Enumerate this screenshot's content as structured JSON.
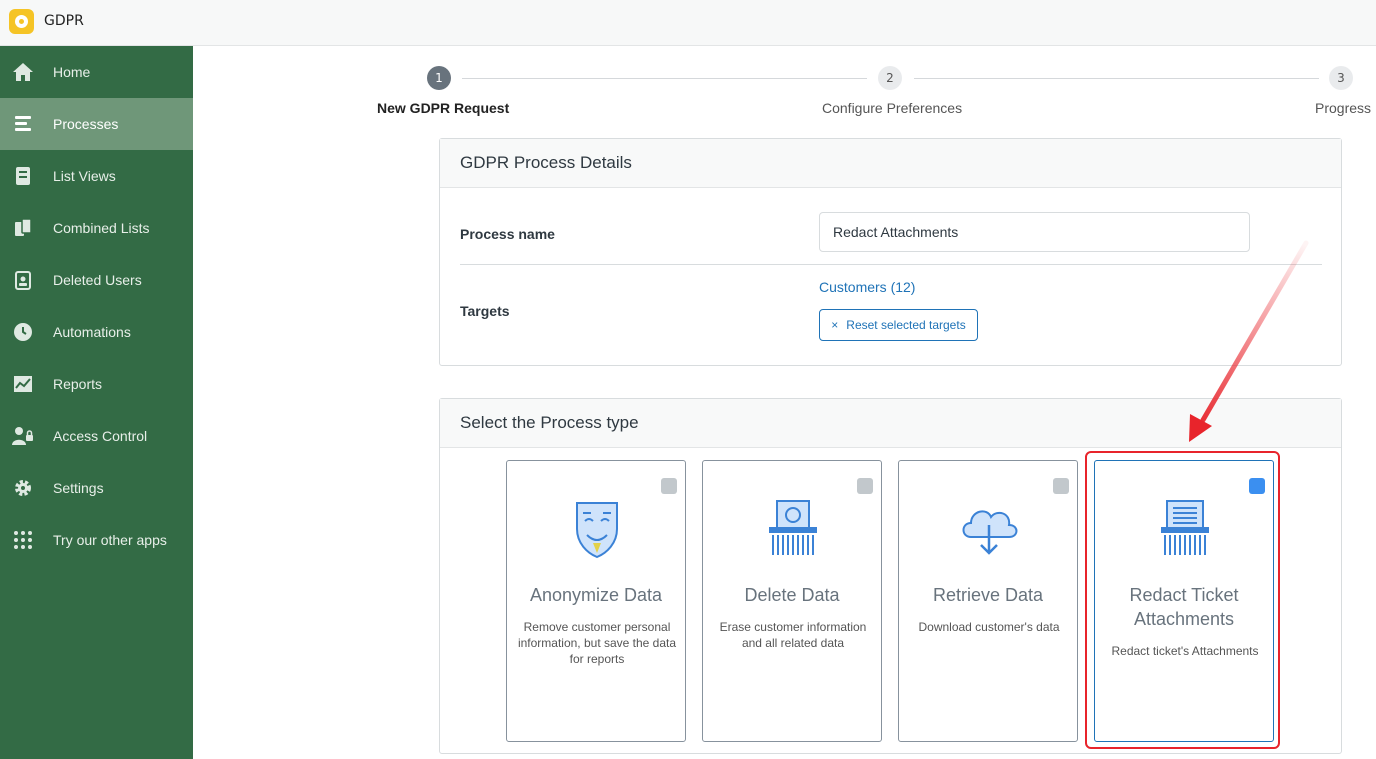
{
  "app": {
    "title": "GDPR"
  },
  "sidebar": {
    "items": [
      {
        "label": "Home",
        "icon": "home-icon"
      },
      {
        "label": "Processes",
        "icon": "processes-icon",
        "active": true
      },
      {
        "label": "List Views",
        "icon": "list-views-icon"
      },
      {
        "label": "Combined Lists",
        "icon": "combined-lists-icon"
      },
      {
        "label": "Deleted Users",
        "icon": "deleted-users-icon"
      },
      {
        "label": "Automations",
        "icon": "clock-icon"
      },
      {
        "label": "Reports",
        "icon": "chart-icon"
      },
      {
        "label": "Access Control",
        "icon": "user-lock-icon"
      },
      {
        "label": "Settings",
        "icon": "gear-icon"
      },
      {
        "label": "Try our other apps",
        "icon": "grid-dots-icon"
      }
    ]
  },
  "stepper": {
    "steps": [
      {
        "number": "1",
        "label": "New GDPR Request",
        "active": true
      },
      {
        "number": "2",
        "label": "Configure Preferences"
      },
      {
        "number": "3",
        "label": "Progress"
      }
    ]
  },
  "details": {
    "header": "GDPR Process Details",
    "process_name_label": "Process name",
    "process_name_value": "Redact Attachments",
    "targets_label": "Targets",
    "targets_link": "Customers (12)",
    "reset_label": "Reset selected targets",
    "reset_icon": "×"
  },
  "process_type": {
    "header": "Select the Process type",
    "cards": [
      {
        "title": "Anonymize Data",
        "desc": "Remove customer personal information, but save the data for reports",
        "icon": "mask-icon",
        "selected": false
      },
      {
        "title": "Delete Data",
        "desc": "Erase customer information and all related data",
        "icon": "shredder-icon",
        "selected": false
      },
      {
        "title": "Retrieve Data",
        "desc": "Download customer's data",
        "icon": "cloud-download-icon",
        "selected": false
      },
      {
        "title": "Redact Ticket Attachments",
        "desc": "Redact ticket's Attachments",
        "icon": "document-shredder-icon",
        "selected": true
      }
    ]
  },
  "colors": {
    "sidebar_bg": "#336b45",
    "sidebar_active": "#6f9779",
    "link": "#1f73b7",
    "highlight": "#e8242b",
    "checkbox_selected": "#3b8ff0"
  }
}
